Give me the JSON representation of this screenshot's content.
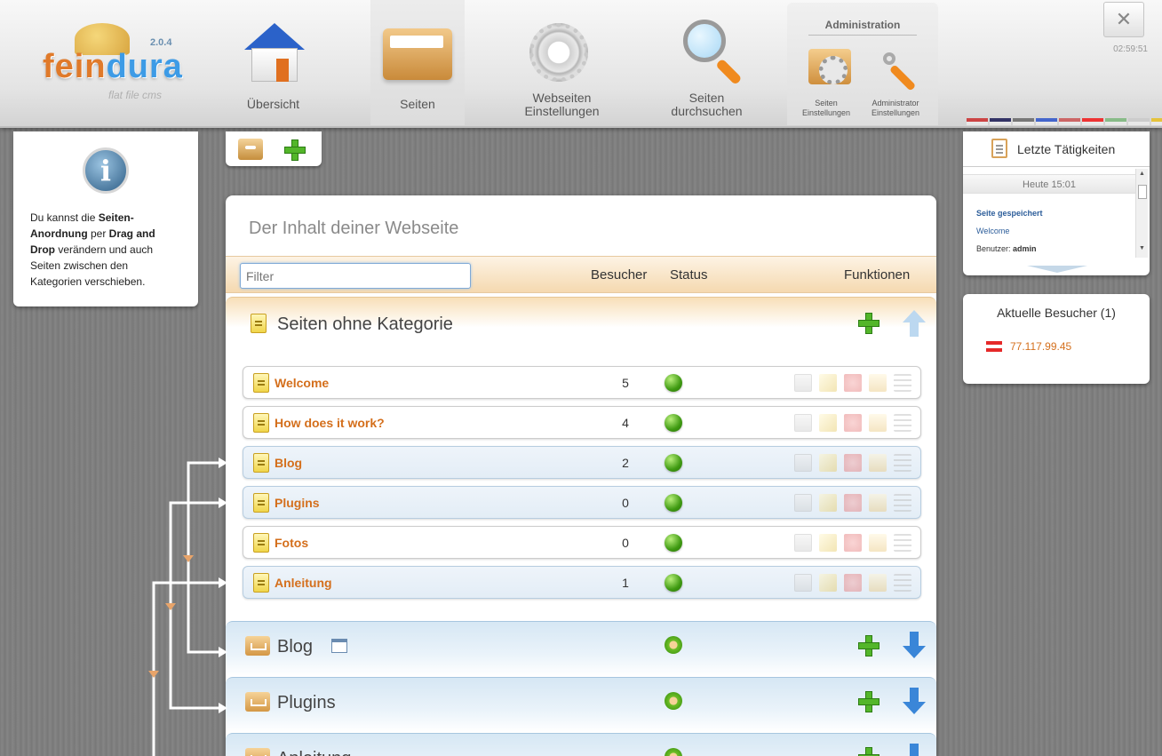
{
  "app": {
    "logo_word_a": "fein",
    "logo_word_b": "dura",
    "version": "2.0.4",
    "tagline": "flat file cms"
  },
  "nav": {
    "overview": "Übersicht",
    "pages": "Seiten",
    "website_settings_1": "Webseiten",
    "website_settings_2": "Einstellungen",
    "search_1": "Seiten",
    "search_2": "durchsuchen",
    "admin_title": "Administration",
    "page_settings_1": "Seiten",
    "page_settings_2": "Einstellungen",
    "admin_settings_1": "Administrator",
    "admin_settings_2": "Einstellungen",
    "close": "✕",
    "clock": "02:59:51",
    "flag_colors": [
      "#c44",
      "#336",
      "#777",
      "#46c",
      "#c66",
      "#e33",
      "#8b8",
      "#ccc",
      "#e5c23b"
    ]
  },
  "info": {
    "t1": "Du kannst die ",
    "b1": "Seiten-Anordnung",
    "t2": " per ",
    "b2": "Drag and Drop",
    "t3": " verändern und auch Seiten zwischen den Kategorien verschieben."
  },
  "content": {
    "title": "Der Inhalt deiner Webseite",
    "filter_placeholder": "Filter",
    "col_visitors": "Besucher",
    "col_status": "Status",
    "col_functions": "Funktionen",
    "cat_none": "Seiten ohne Kategorie",
    "pages": [
      {
        "name": "Welcome",
        "visitors": "5"
      },
      {
        "name": "How does it work?",
        "visitors": "4"
      },
      {
        "name": "Blog",
        "visitors": "2"
      },
      {
        "name": "Plugins",
        "visitors": "0"
      },
      {
        "name": "Fotos",
        "visitors": "0"
      },
      {
        "name": "Anleitung",
        "visitors": "1"
      }
    ],
    "cat_blog": "Blog",
    "cat_plugins": "Plugins",
    "cat_partial": "Anleitung"
  },
  "activity": {
    "title": "Letzte Tätigkeiten",
    "date": "Heute 15:01",
    "l1": "Seite gespeichert",
    "l2": "Welcome",
    "l3_label": "Benutzer: ",
    "l3_user": "admin"
  },
  "visitors": {
    "title": "Aktuelle Besucher (1)",
    "ip": "77.117.99.45"
  }
}
